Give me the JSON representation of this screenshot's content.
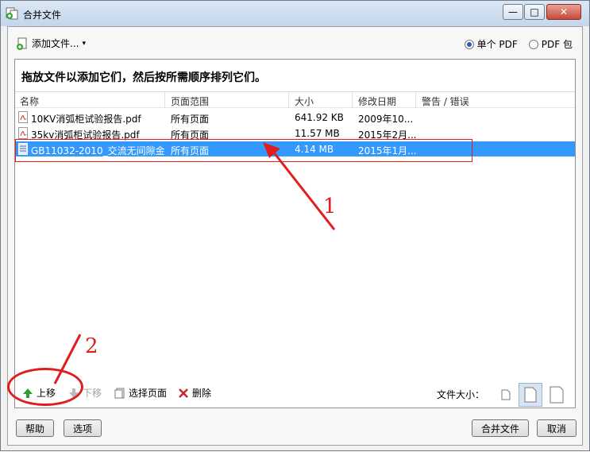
{
  "window": {
    "title": "合并文件",
    "controls": {
      "minimize": "—",
      "maximize": "□",
      "close": "✕"
    }
  },
  "toolbar": {
    "add_files_label": "添加文件...",
    "add_files_dropdown": "▾",
    "radio_single": "单个 PDF",
    "radio_package": "PDF 包",
    "selected_mode": "single"
  },
  "instruction": "拖放文件以添加它们，然后按所需顺序排列它们。",
  "columns": [
    "名称",
    "页面范围",
    "大小",
    "修改日期",
    "警告 / 错误"
  ],
  "files": [
    {
      "name": "10KV消弧柜试验报告.pdf",
      "pages": "所有页面",
      "size": "641.92 KB",
      "modified": "2009年10...",
      "warning": ""
    },
    {
      "name": "35kv消弧柜试验报告.pdf",
      "pages": "所有页面",
      "size": "11.57 MB",
      "modified": "2015年2月...",
      "warning": ""
    },
    {
      "name": "GB11032-2010_交流无间隙金...",
      "pages": "所有页面",
      "size": "4.14 MB",
      "modified": "2015年1月...",
      "warning": "",
      "selected": true
    }
  ],
  "bottom_tools": {
    "move_up": "上移",
    "move_down": "下移",
    "select_pages": "选择页面",
    "delete": "删除",
    "file_size_label": "文件大小："
  },
  "footer": {
    "help": "帮助",
    "options": "选项",
    "merge": "合并文件",
    "cancel": "取消"
  },
  "annotations": {
    "label_1": "1",
    "label_2": "2",
    "color": "#e01e1e"
  },
  "colors": {
    "selection": "#3399ff",
    "titlebar": "#c4d6ec"
  }
}
